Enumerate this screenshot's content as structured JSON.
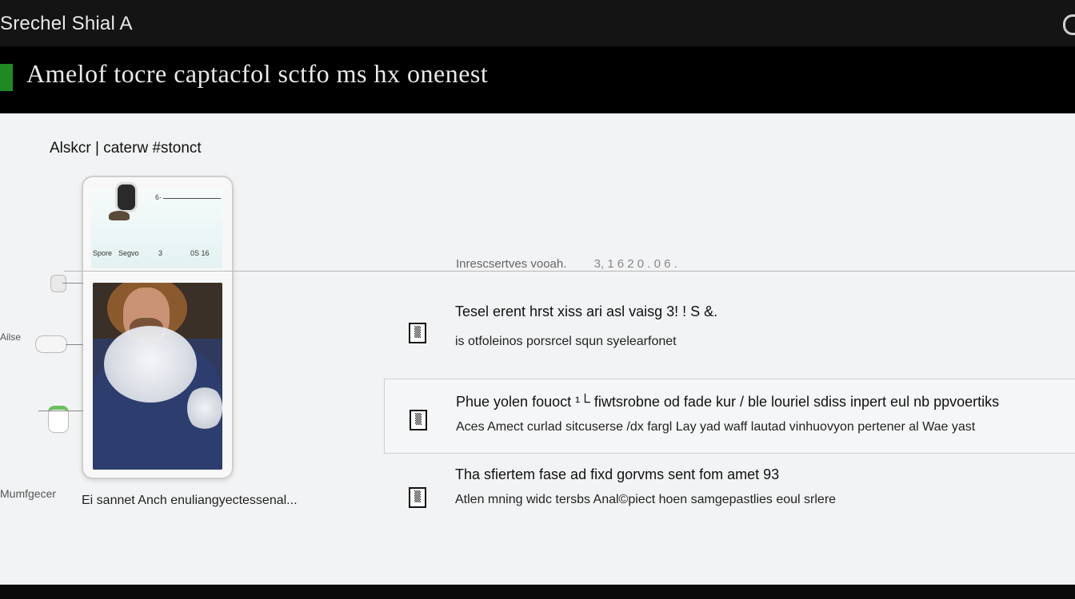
{
  "window": {
    "title": "Srechel Shial A"
  },
  "banner": {
    "heading": "Amelof tocre captacfol sctfo ms hx onenest"
  },
  "section": {
    "label": "Alskcr | caterw #stonct"
  },
  "phone": {
    "mini_label": "6·",
    "meta_left": "Spore",
    "meta_mid": "Segvo",
    "meta_right_a": "3",
    "meta_right_b": "0S 16"
  },
  "rail": {
    "item_a_label": "",
    "item_b_label": "Ailse",
    "left_caption": "Mumfgecer"
  },
  "phone_caption": "Ei sannet Anch enuliangyectessenal...",
  "info": {
    "meta_a": "Inrescsertves vooah.",
    "meta_b": "3, 1 6 2 0 . 0 6 ."
  },
  "features": [
    {
      "icon": "▒",
      "line1": "Tesel erent hrst xiss ari asl vaisg 3! ! S &.",
      "line2": "is otfoleinos porsrcel squn syelearfonet"
    },
    {
      "icon": "▒",
      "line1": "Phue yolen fouoct ¹└ fiwtsrobne od fade kur / ble louriel sdiss inpert eul nb ppvoertiks",
      "line2": "Aces Amect curlad sitcuserse /dx fargl Lay yad waff lautad vinhuovyon pertener al Wae yast"
    },
    {
      "icon": "▒",
      "line1": "Tha sfiertem fase ad fixd gorvms sent fom amet 93",
      "line2": "Atlen mning widc tersbs Anal©piect hoen samgepastlies eoul srlere"
    }
  ],
  "colors": {
    "accent": "#1f8a21",
    "topbar": "#141414",
    "banner": "#000000",
    "panel": "#f2f3f4"
  }
}
